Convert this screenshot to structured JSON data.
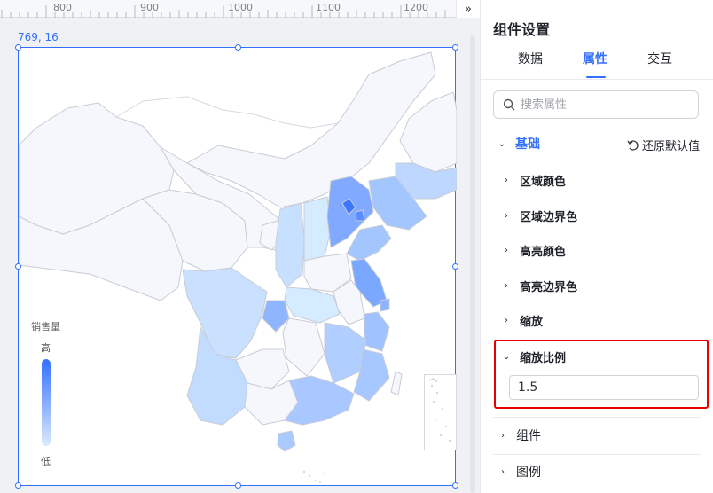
{
  "ruler": {
    "labels": [
      "800",
      "900",
      "1000",
      "1100",
      "1200"
    ],
    "expand_icon": "double-chevron-right-icon"
  },
  "canvas": {
    "coords": "769, 16"
  },
  "map": {
    "legend": {
      "title": "销售量",
      "high": "高",
      "low": "低"
    },
    "colors": {
      "border": "#c8ccd6",
      "empty": "#f5f7fc",
      "max": "#3370ff",
      "min": "#dbeaff"
    }
  },
  "panel": {
    "title": "组件设置",
    "tabs": [
      {
        "label": "数据"
      },
      {
        "label": "属性"
      },
      {
        "label": "交互"
      }
    ],
    "active_tab": "属性",
    "search": {
      "placeholder": "搜索属性",
      "value": ""
    },
    "basic": {
      "label": "基础",
      "reset_label": "还原默认值"
    },
    "items": [
      {
        "label": "区域颜色"
      },
      {
        "label": "区域边界色"
      },
      {
        "label": "高亮颜色"
      },
      {
        "label": "高亮边界色"
      },
      {
        "label": "缩放"
      }
    ],
    "scale_ratio": {
      "label": "缩放比例",
      "value": "1.5"
    },
    "sections": [
      {
        "label": "组件"
      },
      {
        "label": "图例"
      }
    ]
  }
}
